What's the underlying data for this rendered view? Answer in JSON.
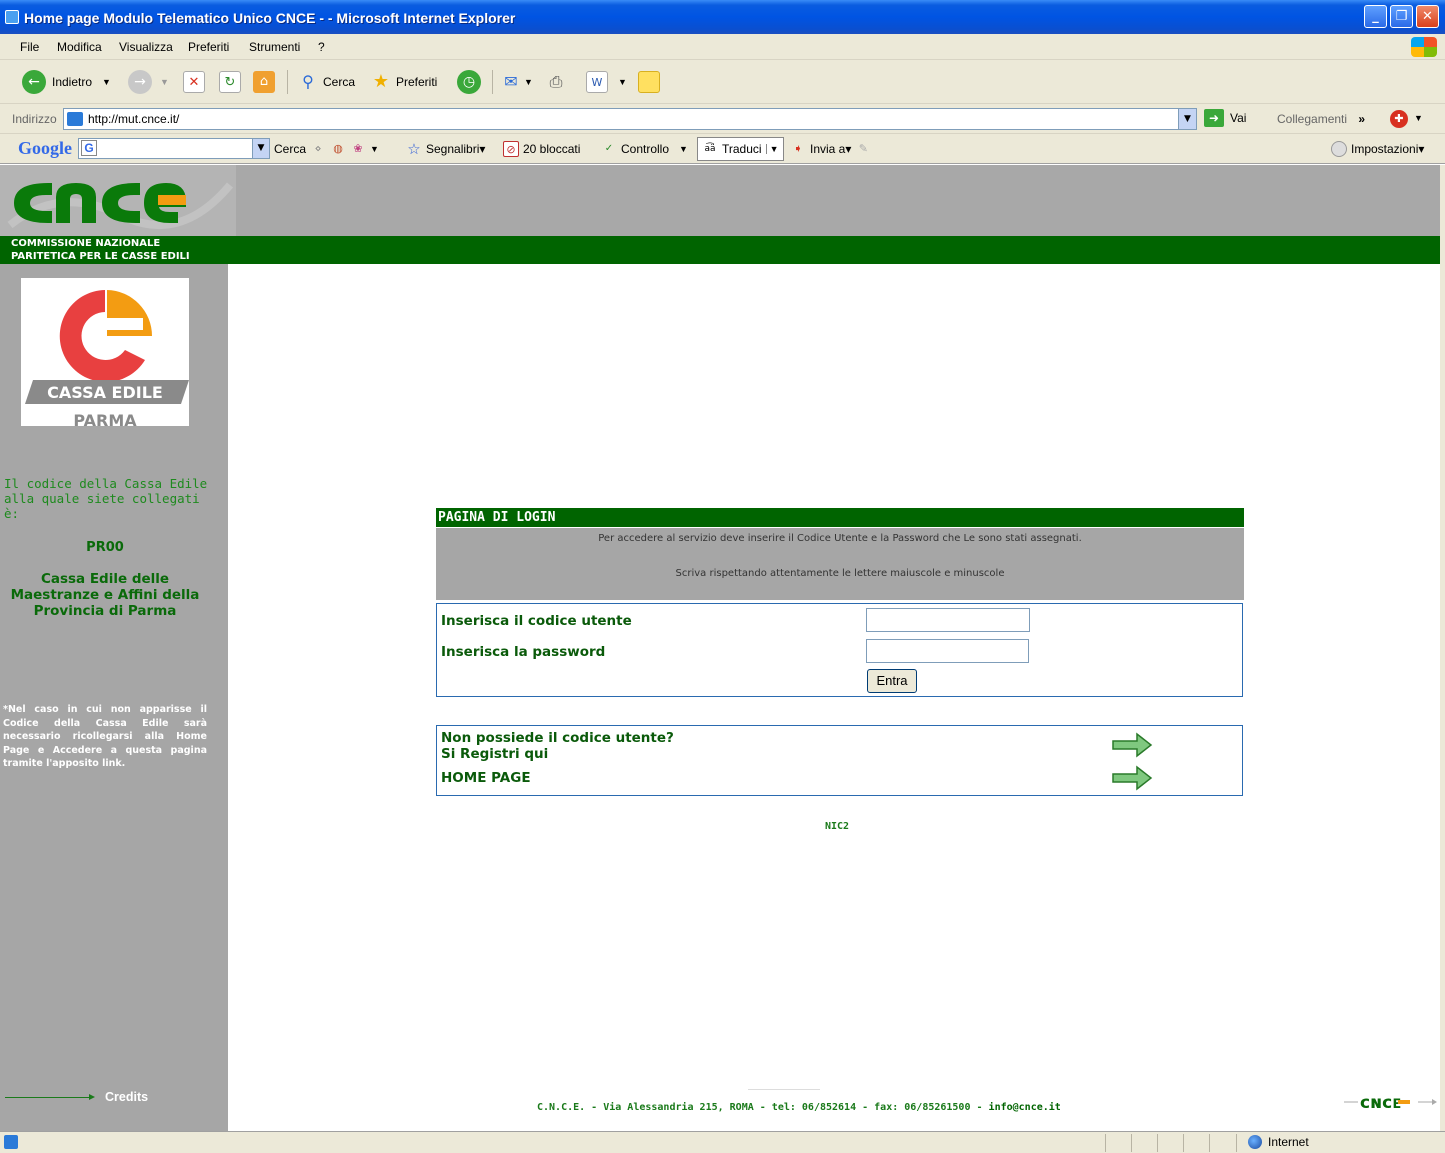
{
  "window": {
    "title": "Home page Modulo Telematico Unico CNCE - - Microsoft Internet Explorer",
    "minimize": "_",
    "maximize": "❐",
    "close": "✕"
  },
  "menu": [
    "File",
    "Modifica",
    "Visualizza",
    "Preferiti",
    "Strumenti",
    "?"
  ],
  "toolbar": {
    "back": "Indietro",
    "search": "Cerca",
    "favorites": "Preferiti"
  },
  "address": {
    "label": "Indirizzo",
    "url": "http://mut.cnce.it/",
    "go": "Vai",
    "links": "Collegamenti",
    "more": "»"
  },
  "google_bar": {
    "logo": "Google",
    "search": "Cerca",
    "bookmarks": "Segnalibri▾",
    "blocked": "20 bloccati",
    "spell": "Controllo",
    "translate": "Traduci",
    "send": "Invia a▾",
    "settings": "Impostazioni▾"
  },
  "header": {
    "org_name": "COMMISSIONE NAZIONALE\nPARITETICA PER LE CASSE EDILI"
  },
  "sidebar": {
    "logo_line1": "CASSA EDILE",
    "logo_line2": "PARMA",
    "code_label": "Il codice della Cassa Edile alla quale siete collegati è:",
    "code": "PR00",
    "cassa_name": "Cassa Edile delle Maestranze e Affini della Provincia di Parma",
    "note": "*Nel caso in cui non apparisse il Codice della Cassa Edile sarà necessario ricollegarsi alla Home Page e Accedere a questa pagina tramite l'apposito link.",
    "credits": "Credits"
  },
  "login": {
    "heading": "PAGINA DI LOGIN",
    "info1": "Per accedere al servizio deve inserire il Codice Utente e la Password che Le sono stati assegnati.",
    "info2": "Scriva rispettando attentamente le lettere maiuscole e minuscole",
    "user_label": "Inserisca il codice utente",
    "user_value": "",
    "password_label": "Inserisca la password",
    "password_value": "",
    "submit": "Entra"
  },
  "links": {
    "register_line1": "Non possiede il codice utente?",
    "register_line2": "Si Registri qui",
    "home": "HOME PAGE"
  },
  "nic": "NIC2",
  "footer": {
    "text": "C.N.C.E. - Via Alessandria 215, ROMA - tel: 06/852614 - fax: 06/85261500 - ",
    "email": "info@cnce.it"
  },
  "statusbar": {
    "zone": "Internet"
  },
  "colors": {
    "brand_green": "#006400",
    "sidebar_gray": "#a6a6a6",
    "logo_orange": "#f39c12",
    "logo_red": "#e84040"
  }
}
